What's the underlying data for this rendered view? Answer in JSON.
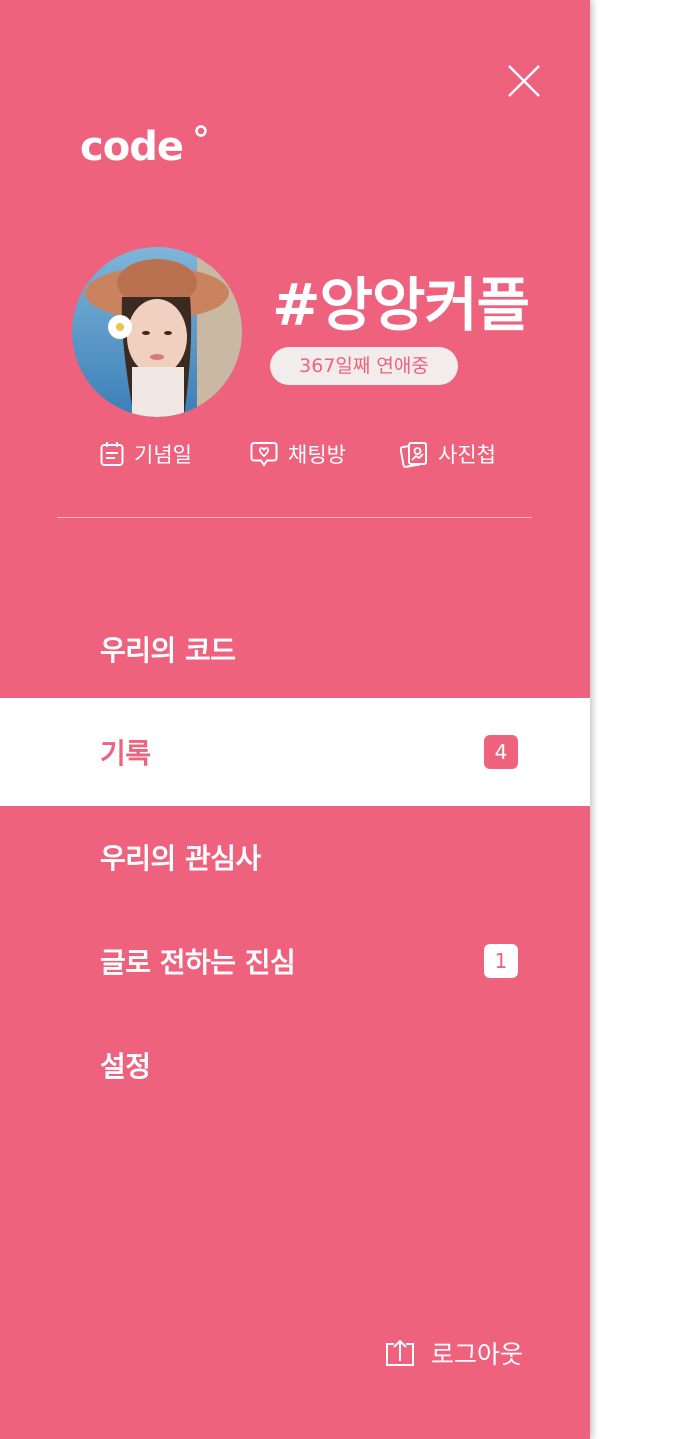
{
  "colors": {
    "accent": "#ef627e",
    "pill_bg": "#f3ecec",
    "white": "#ffffff"
  },
  "header": {
    "close_icon": "close-icon",
    "logo_icon": "code-logo",
    "logo_text": "code"
  },
  "profile": {
    "avatar_icon": "profile-photo",
    "couple_name": "#앙앙커플",
    "days_label": "367일째 연애중"
  },
  "quick_links": [
    {
      "label": "기념일",
      "icon": "calendar-icon"
    },
    {
      "label": "채팅방",
      "icon": "chat-heart-icon"
    },
    {
      "label": "사진첩",
      "icon": "photo-album-icon"
    }
  ],
  "menu": [
    {
      "label": "우리의 코드",
      "badge": null,
      "active": false
    },
    {
      "label": "기록",
      "badge": "4",
      "active": true
    },
    {
      "label": "우리의 관심사",
      "badge": null,
      "active": false
    },
    {
      "label": "글로 전하는 진심",
      "badge": "1",
      "active": false
    },
    {
      "label": "설정",
      "badge": null,
      "active": false
    }
  ],
  "logout": {
    "label": "로그아웃",
    "icon": "logout-icon"
  }
}
